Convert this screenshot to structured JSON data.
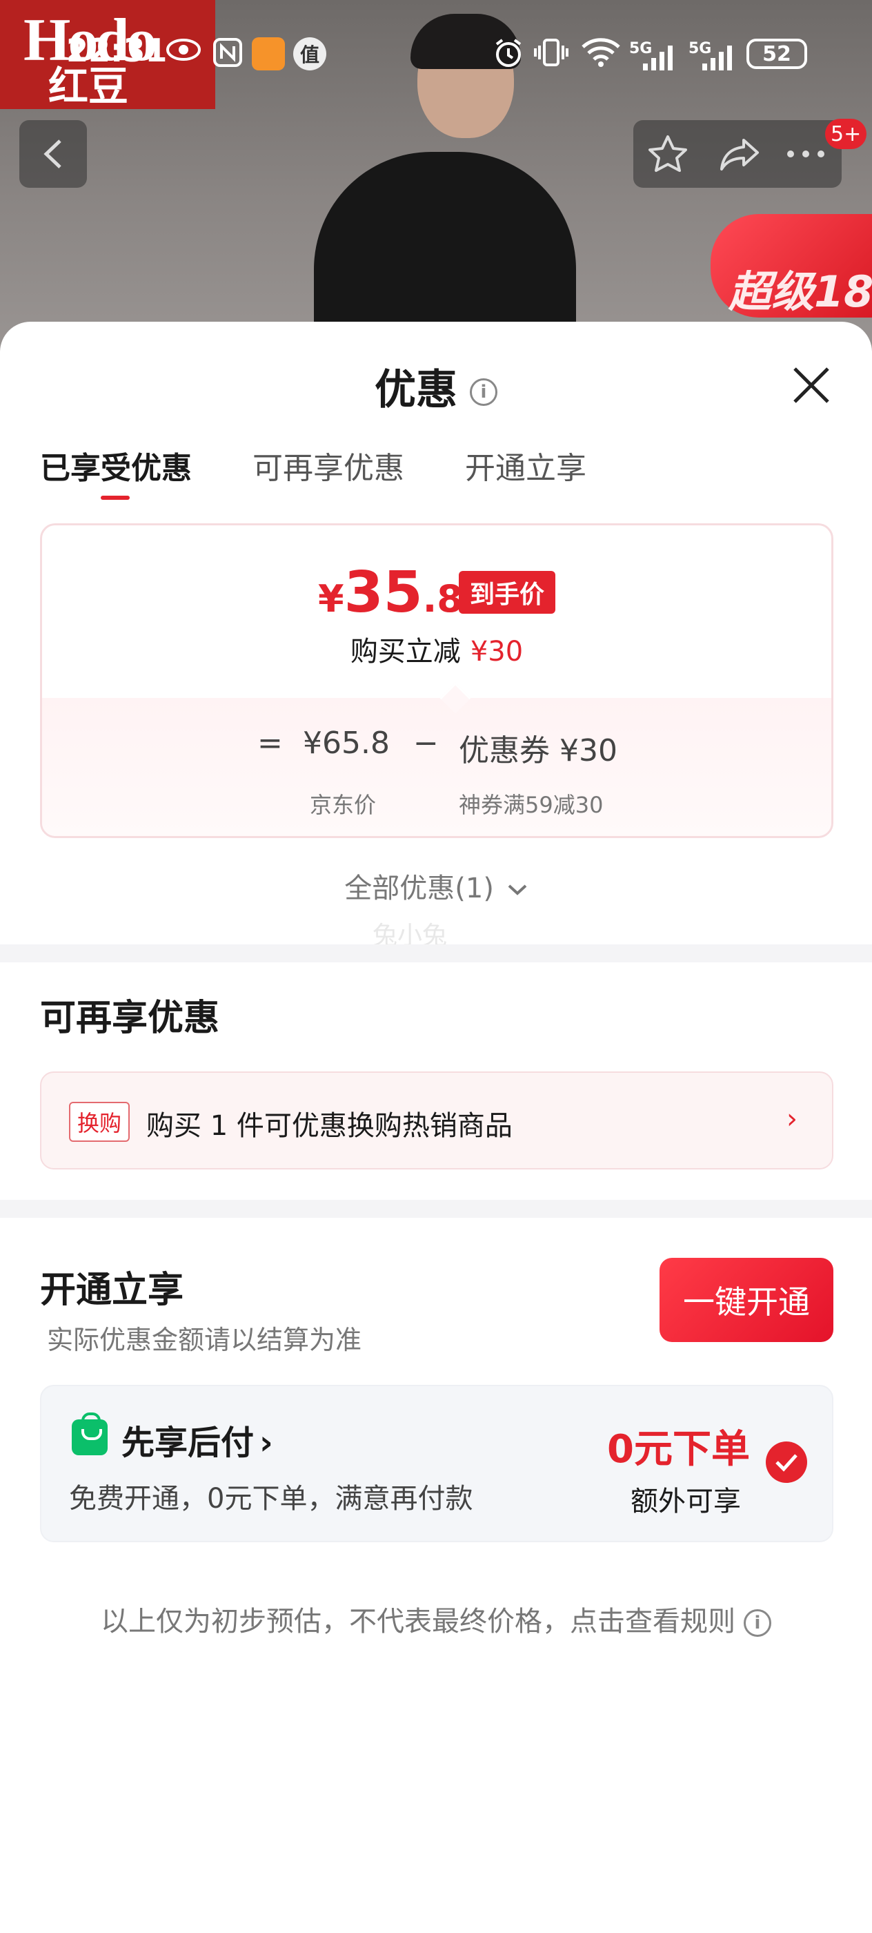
{
  "status_bar": {
    "time": "22:31",
    "badge_text": "值",
    "signal_1": "5G",
    "signal_2": "5G",
    "battery": "52"
  },
  "hero": {
    "brand_logo_text_1": "Hodo",
    "brand_logo_text_2": "红豆",
    "promo_text": "超级18",
    "nav_badge": "5+"
  },
  "sheet": {
    "title": "优惠",
    "info_glyph": "i",
    "tabs": [
      {
        "label": "已享受优惠",
        "active": true
      },
      {
        "label": "可再享优惠",
        "active": false
      },
      {
        "label": "开通立享",
        "active": false
      }
    ],
    "price_card": {
      "currency": "¥",
      "price_int": "35",
      "price_dec": ".8",
      "price_badge": "到手价",
      "reduce_label": "购买立减",
      "reduce_amount": "¥30",
      "formula_eq": "=",
      "jd_price": "¥65.8",
      "formula_minus": "−",
      "coupon": "优惠券 ¥30",
      "jd_price_label": "京东价",
      "coupon_label": "神券满59减30"
    },
    "all_discounts": "全部优惠(1)",
    "watermark": "兔小兔",
    "more_section": {
      "title": "可再享优惠",
      "tag": "换购",
      "text": "购买 1 件可优惠换购热销商品",
      "arrow": "›"
    },
    "open_section": {
      "title": "开通立享",
      "note": "实际优惠金额请以结算为准",
      "button": "一键开通",
      "pay_title": "先享后付",
      "pay_chevron": "›",
      "pay_desc": "免费开通，0元下单，满意再付款",
      "pay_value": "0元下单",
      "pay_value_sub": "额外可享"
    },
    "footer_note": "以上仅为初步预估，不代表最终价格，点击查看规则"
  },
  "colors": {
    "accent": "#e4232d",
    "pay_green": "#0bbf6a"
  }
}
